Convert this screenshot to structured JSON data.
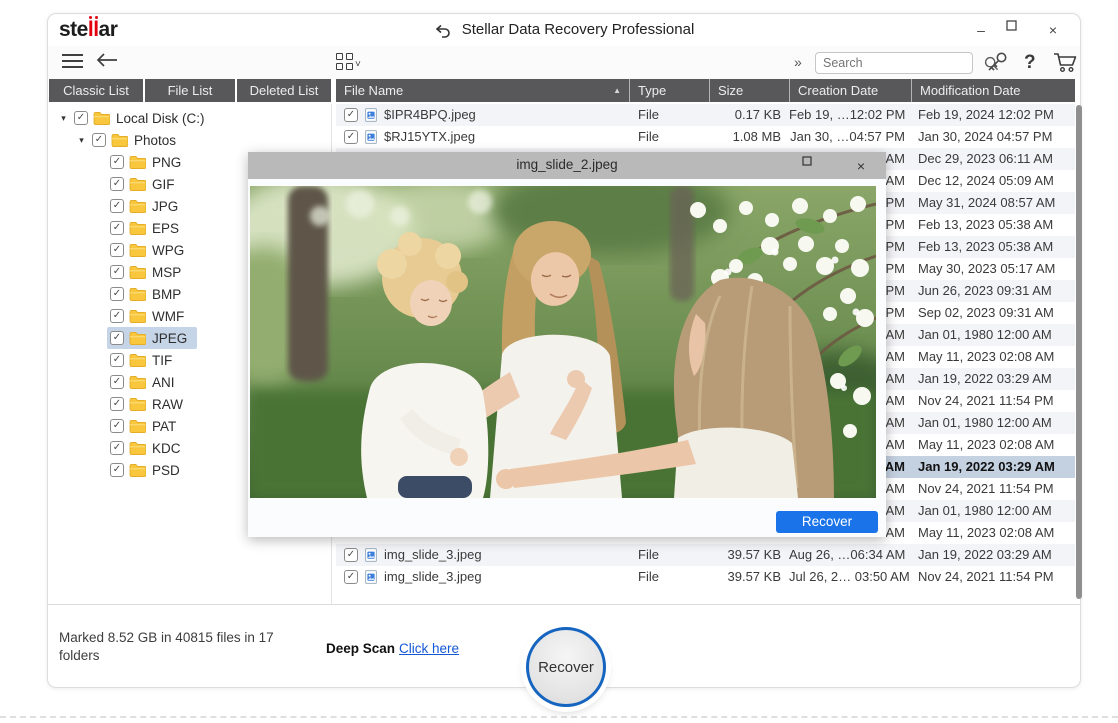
{
  "logo": {
    "prefix": "ste",
    "accent": "ll",
    "suffix": "ar"
  },
  "window": {
    "title": "Stellar Data Recovery Professional",
    "controls": {
      "minimize": "–",
      "maximize": "",
      "close": "×"
    }
  },
  "toolbar": {
    "search_placeholder": "Search",
    "overflow_glyph": "»",
    "help_glyph": "?"
  },
  "tabs": [
    {
      "label": "Classic List",
      "active": false
    },
    {
      "label": "File List",
      "active": true
    },
    {
      "label": "Deleted List",
      "active": false
    }
  ],
  "tree": {
    "items": [
      {
        "label": "Local Disk (C:)",
        "level": 0,
        "expanded": true,
        "checked": true,
        "selected": false
      },
      {
        "label": "Photos",
        "level": 1,
        "expanded": true,
        "checked": true,
        "selected": false
      },
      {
        "label": "PNG",
        "level": 2,
        "checked": true,
        "selected": false
      },
      {
        "label": "GIF",
        "level": 2,
        "checked": true,
        "selected": false
      },
      {
        "label": "JPG",
        "level": 2,
        "checked": true,
        "selected": false
      },
      {
        "label": "EPS",
        "level": 2,
        "checked": true,
        "selected": false
      },
      {
        "label": "WPG",
        "level": 2,
        "checked": true,
        "selected": false
      },
      {
        "label": "MSP",
        "level": 2,
        "checked": true,
        "selected": false
      },
      {
        "label": "BMP",
        "level": 2,
        "checked": true,
        "selected": false
      },
      {
        "label": "WMF",
        "level": 2,
        "checked": true,
        "selected": false
      },
      {
        "label": "JPEG",
        "level": 2,
        "checked": true,
        "selected": true
      },
      {
        "label": "TIF",
        "level": 2,
        "checked": true,
        "selected": false
      },
      {
        "label": "ANI",
        "level": 2,
        "checked": true,
        "selected": false
      },
      {
        "label": "RAW",
        "level": 2,
        "checked": true,
        "selected": false
      },
      {
        "label": "PAT",
        "level": 2,
        "checked": true,
        "selected": false
      },
      {
        "label": "KDC",
        "level": 2,
        "checked": true,
        "selected": false
      },
      {
        "label": "PSD",
        "level": 2,
        "checked": true,
        "selected": false
      }
    ]
  },
  "table": {
    "columns": [
      "File Name",
      "Type",
      "Size",
      "Creation Date",
      "Modification Date"
    ],
    "sort_glyph": "▲",
    "check_glyph": "✓",
    "rows": [
      {
        "name": "$IPR4BPQ.jpeg",
        "type": "File",
        "size": "0.17 KB",
        "creation": "Feb 19, …12:02 PM",
        "modification": "Feb 19, 2024 12:02 PM",
        "checked": true,
        "selected": false
      },
      {
        "name": "$RJ15YTX.jpeg",
        "type": "File",
        "size": "1.08 MB",
        "creation": "Jan 30, …04:57 PM",
        "modification": "Jan 30, 2024 04:57 PM",
        "checked": true,
        "selected": false
      },
      {
        "name": "",
        "type": "",
        "size": "",
        "creation": "AM",
        "modification": "Dec 29, 2023 06:11 AM",
        "selected": false
      },
      {
        "name": "",
        "type": "",
        "size": "",
        "creation": "AM",
        "modification": "Dec 12, 2024 05:09 AM",
        "selected": false
      },
      {
        "name": "",
        "type": "",
        "size": "",
        "creation": "PM",
        "modification": "May 31, 2024 08:57 AM",
        "selected": false
      },
      {
        "name": "",
        "type": "",
        "size": "",
        "creation": "PM",
        "modification": "Feb 13, 2023 05:38 AM",
        "selected": false
      },
      {
        "name": "",
        "type": "",
        "size": "",
        "creation": "PM",
        "modification": "Feb 13, 2023 05:38 AM",
        "selected": false
      },
      {
        "name": "",
        "type": "",
        "size": "",
        "creation": "PM",
        "modification": "May 30, 2023 05:17 AM",
        "selected": false
      },
      {
        "name": "",
        "type": "",
        "size": "",
        "creation": "PM",
        "modification": "Jun 26, 2023 09:31 AM",
        "selected": false
      },
      {
        "name": "",
        "type": "",
        "size": "",
        "creation": "PM",
        "modification": "Sep 02, 2023 09:31 AM",
        "selected": false
      },
      {
        "name": "",
        "type": "",
        "size": "",
        "creation": "AM",
        "modification": "Jan 01, 1980 12:00 AM",
        "selected": false
      },
      {
        "name": "",
        "type": "",
        "size": "",
        "creation": "AM",
        "modification": "May 11, 2023 02:08 AM",
        "selected": false
      },
      {
        "name": "",
        "type": "",
        "size": "",
        "creation": "AM",
        "modification": "Jan 19, 2022 03:29 AM",
        "selected": false
      },
      {
        "name": "",
        "type": "",
        "size": "",
        "creation": "AM",
        "modification": "Nov 24, 2021 11:54 PM",
        "selected": false
      },
      {
        "name": "",
        "type": "",
        "size": "",
        "creation": "AM",
        "modification": "Jan 01, 1980 12:00 AM",
        "selected": false
      },
      {
        "name": "",
        "type": "",
        "size": "",
        "creation": "AM",
        "modification": "May 11, 2023 02:08 AM",
        "selected": false
      },
      {
        "name": "",
        "type": "",
        "size": "",
        "creation": "AM",
        "modification": "Jan 19, 2022 03:29 AM",
        "selected": true
      },
      {
        "name": "",
        "type": "",
        "size": "",
        "creation": "AM",
        "modification": "Nov 24, 2021 11:54 PM",
        "selected": false
      },
      {
        "name": "",
        "type": "",
        "size": "",
        "creation": "AM",
        "modification": "Jan 01, 1980 12:00 AM",
        "selected": false
      },
      {
        "name": "",
        "type": "",
        "size": "",
        "creation": "AM",
        "modification": "May 11, 2023 02:08 AM",
        "selected": false
      },
      {
        "name": "img_slide_3.jpeg",
        "type": "File",
        "size": "39.57 KB",
        "creation": "Aug 26, …06:34 AM",
        "modification": "Jan 19, 2022 03:29 AM",
        "checked": true,
        "selected": false
      },
      {
        "name": "img_slide_3.jpeg",
        "type": "File",
        "size": "39.57 KB",
        "creation": "Jul 26, 2… 03:50 AM",
        "modification": "Nov 24, 2021 11:54 PM",
        "checked": true,
        "selected": false
      }
    ]
  },
  "preview": {
    "title": "img_slide_2.jpeg",
    "recover_label": "Recover",
    "close_glyph": "×"
  },
  "statusbar": {
    "marked_text": "Marked 8.52 GB in 40815 files in 17 folders",
    "deep_scan_label": "Deep Scan",
    "click_here_label": "Click here",
    "recover_label": "Recover"
  },
  "colors": {
    "accent_blue": "#1a73e8",
    "header_gray": "#58585a",
    "selection_blue": "#c4d1e1",
    "brand_red": "#e3000f",
    "link_blue": "#1558d6"
  }
}
